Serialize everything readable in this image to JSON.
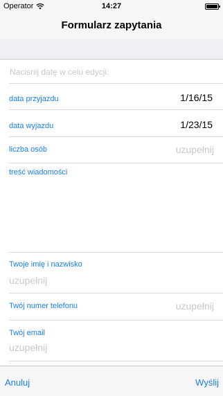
{
  "status_bar": {
    "carrier": "Operator",
    "time": "14:27"
  },
  "nav": {
    "title": "Formularz zapytania"
  },
  "form": {
    "hint": "Nacisnij datę w celu edycji:",
    "arrival_label": "data przyjazdu",
    "arrival_value": "1/16/15",
    "departure_label": "data wyjazdu",
    "departure_value": "1/23/15",
    "people_label": "liczba osób",
    "people_placeholder": "uzupełnij",
    "message_label": "treść wiadomości",
    "name_label": "Twoje imię i nazwisko",
    "name_placeholder": "uzupełnij",
    "phone_label": "Twój numer telefonu",
    "phone_placeholder": "uzupełnij",
    "email_label": "Twój email",
    "email_placeholder": "uzupełnij"
  },
  "toolbar": {
    "cancel_label": "Anuluj",
    "send_label": "Wyślij"
  },
  "colors": {
    "accent": "#157efb",
    "placeholder": "#c7c7cd",
    "grouped_background": "#efeff4"
  }
}
